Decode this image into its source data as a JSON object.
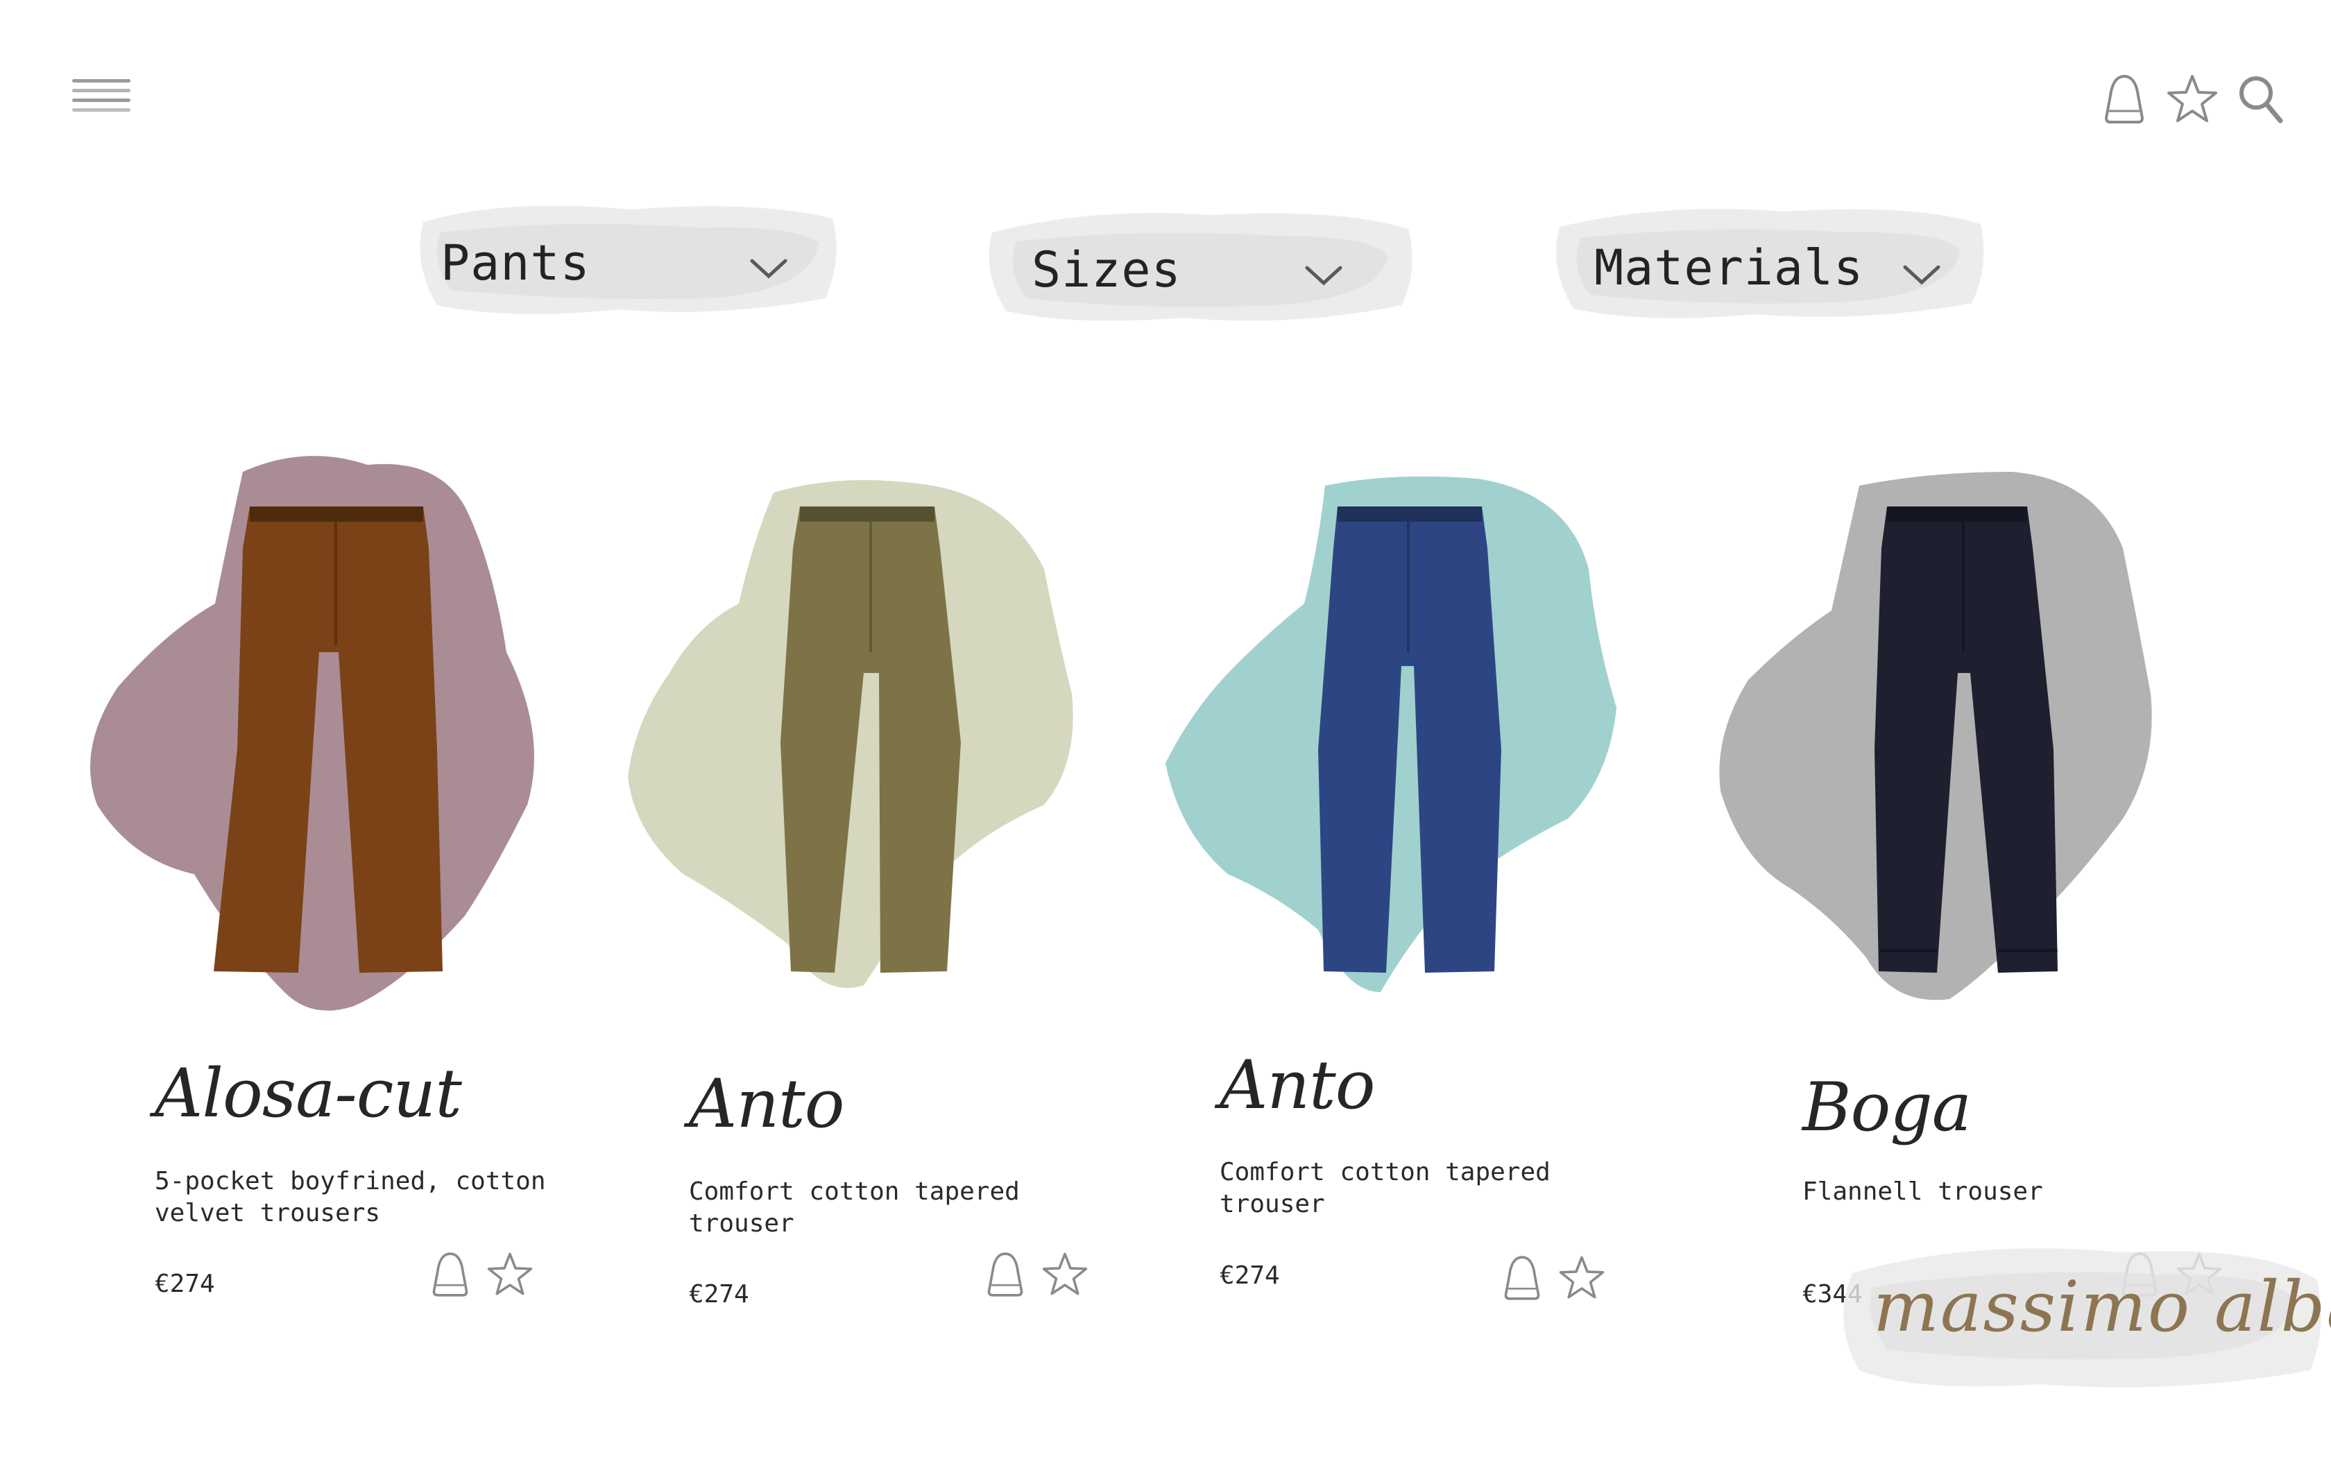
{
  "header": {
    "menu_icon": "hamburger-menu-icon",
    "actions": [
      {
        "name": "bag",
        "icon": "shopping-bag-icon"
      },
      {
        "name": "favorites",
        "icon": "star-icon"
      },
      {
        "name": "search",
        "icon": "search-icon"
      }
    ]
  },
  "filters": [
    {
      "label": "Pants",
      "icon": "chevron-down-icon"
    },
    {
      "label": "Sizes",
      "icon": "chevron-down-icon"
    },
    {
      "label": "Materials",
      "icon": "chevron-down-icon"
    }
  ],
  "products": [
    {
      "name": "Alosa-cut",
      "description": "5-pocket boyfrined, cotton velvet trousers",
      "price": "€274",
      "garment_color": "#7a4216",
      "splash_color": "#9b7882"
    },
    {
      "name": "Anto",
      "description": "Comfort cotton tapered trouser",
      "price": "€274",
      "garment_color": "#7d7347",
      "splash_color": "#cfd0b4"
    },
    {
      "name": "Anto",
      "description": "Comfort cotton tapered trouser",
      "price": "€274",
      "garment_color": "#2d4683",
      "splash_color": "#8fc9c6"
    },
    {
      "name": "Boga",
      "description": "Flannell trouser",
      "price": "€344",
      "garment_color": "#1e2030",
      "splash_color": "#a4a4a4"
    }
  ],
  "brand": {
    "logo_text": "massimo alba",
    "logo_color": "#8e7552"
  }
}
